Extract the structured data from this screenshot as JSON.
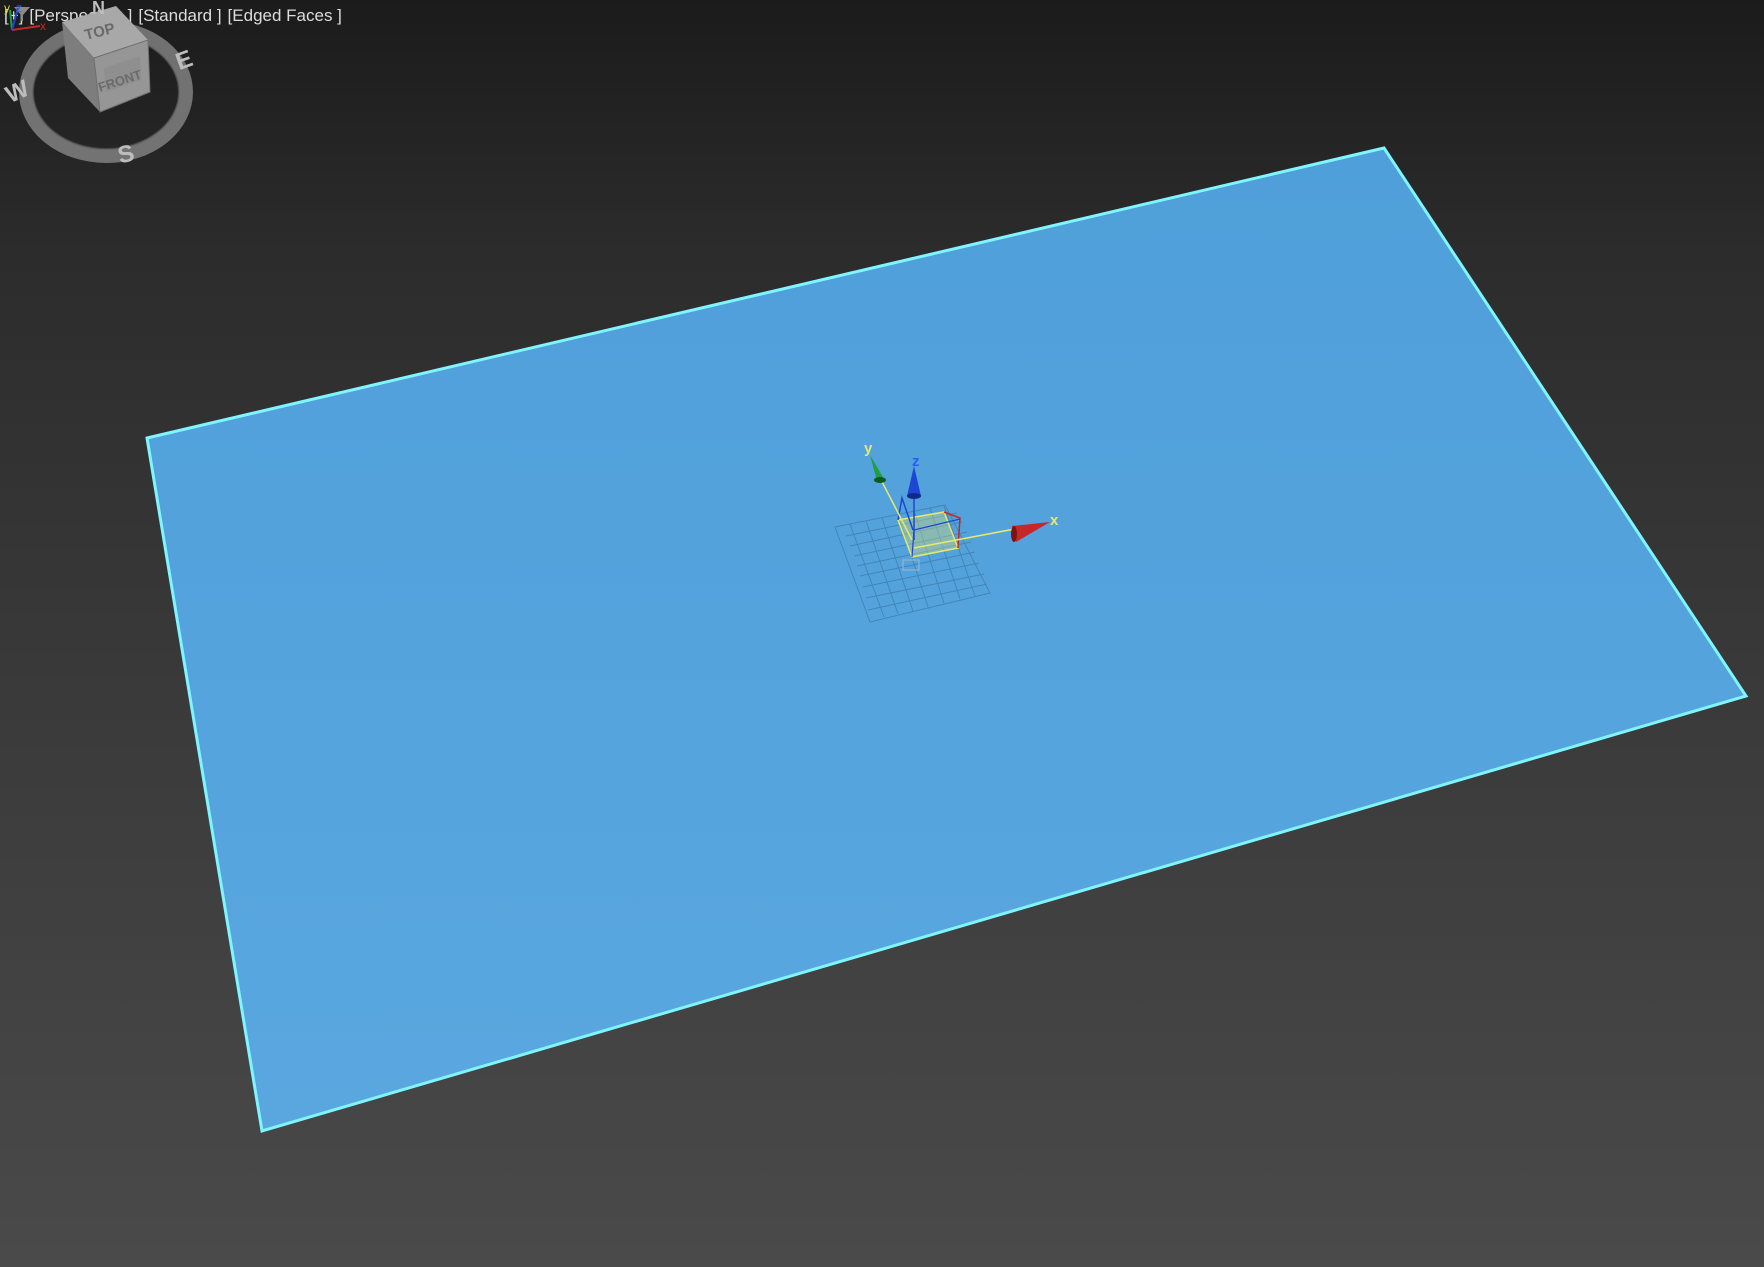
{
  "viewport": {
    "labels": {
      "menu": "[+]",
      "view": "[Perspective ]",
      "shading": "[Standard ]",
      "display": "[Edged Faces ]"
    },
    "filter_icon": "filter-icon"
  },
  "viewcube": {
    "top_label": "TOP",
    "front_label": "FRONT",
    "compass": {
      "west": "W",
      "east": "E",
      "south": "S",
      "north": "N"
    }
  },
  "gizmo": {
    "x_label": "x",
    "y_label": "y",
    "z_label": "z"
  },
  "axis_tripod": {
    "x_label": "x",
    "y_label": "y",
    "z_label": "z"
  },
  "colors": {
    "plane_fill": "#55a3dc",
    "plane_edge": "#7ff5ff",
    "x_axis": "#c62828",
    "y_axis": "#1ea03c",
    "z_axis": "#1e46d2",
    "gizmo_plane": "#e8e86a"
  }
}
